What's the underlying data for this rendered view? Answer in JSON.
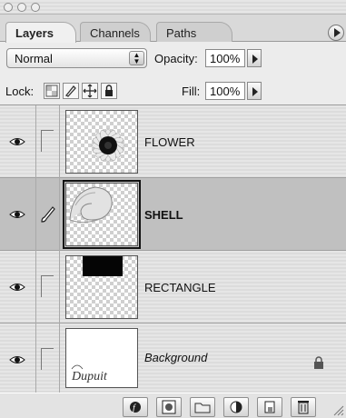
{
  "tabs": [
    {
      "label": "Layers",
      "active": true
    },
    {
      "label": "Channels",
      "active": false
    },
    {
      "label": "Paths",
      "active": false
    }
  ],
  "blend": {
    "mode": "Normal",
    "opacity_label": "Opacity:",
    "opacity_value": "100%"
  },
  "lock": {
    "label": "Lock:",
    "fill_label": "Fill:",
    "fill_value": "100%"
  },
  "layers": [
    {
      "name": "FLOWER",
      "visible": true,
      "selected": false,
      "locked": false
    },
    {
      "name": "SHELL",
      "visible": true,
      "selected": true,
      "locked": false
    },
    {
      "name": "RECTANGLE",
      "visible": true,
      "selected": false,
      "locked": false
    },
    {
      "name": "Background",
      "visible": true,
      "selected": false,
      "locked": true,
      "thumb_signature": "Dupuit"
    }
  ],
  "bottom_buttons": [
    "layer-style-icon",
    "layer-mask-icon",
    "new-group-icon",
    "adjustment-layer-icon",
    "new-layer-icon",
    "trash-icon"
  ],
  "colors": {
    "selected_row": "#c0c0c0",
    "panel": "#ececec"
  }
}
